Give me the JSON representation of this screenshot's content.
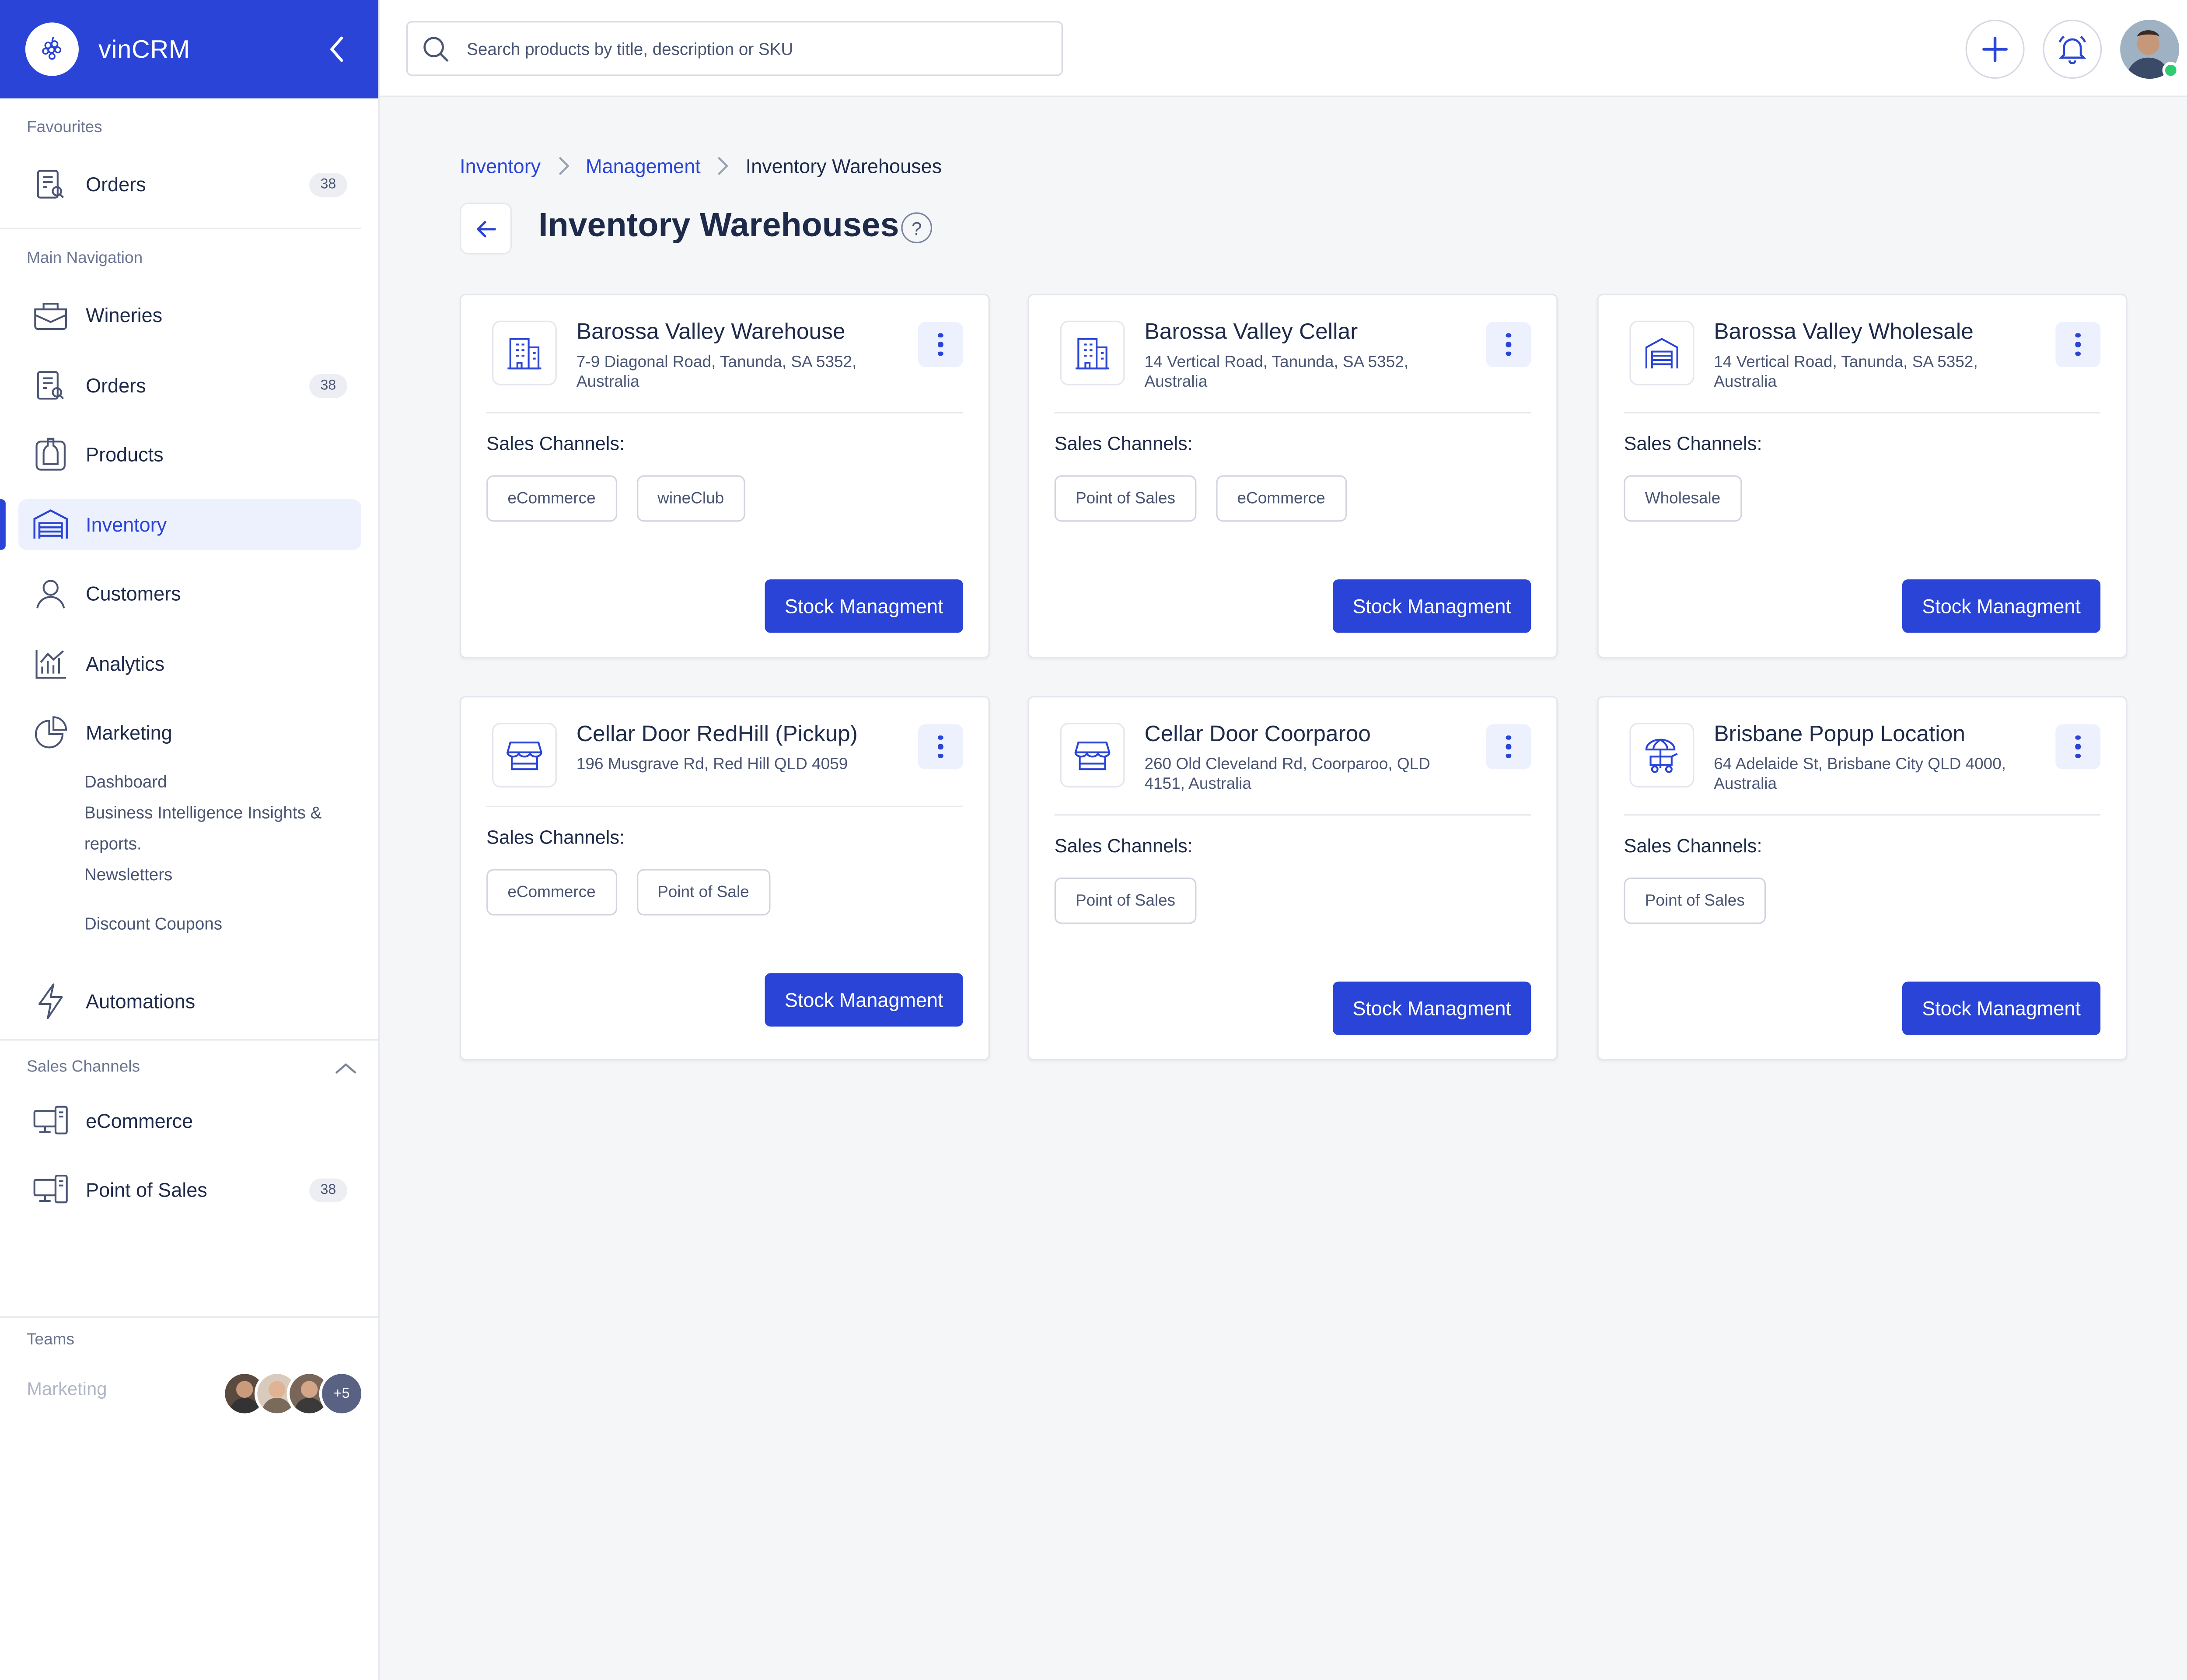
{
  "brand": {
    "name": "vinCRM"
  },
  "search": {
    "placeholder": "Search products by title, description or SKU"
  },
  "sidebar": {
    "favourites_label": "Favourites",
    "favourites": [
      {
        "label": "Orders",
        "badge": "38",
        "icon": "clipboard-search-icon"
      }
    ],
    "main_nav_label": "Main Navigation",
    "items": [
      {
        "label": "Wineries",
        "icon": "wine-case-icon"
      },
      {
        "label": "Orders",
        "badge": "38",
        "icon": "clipboard-search-icon"
      },
      {
        "label": "Products",
        "icon": "bottle-icon"
      },
      {
        "label": "Inventory",
        "icon": "warehouse-icon",
        "active": true
      },
      {
        "label": "Customers",
        "icon": "user-icon"
      },
      {
        "label": "Analytics",
        "icon": "chart-icon"
      },
      {
        "label": "Marketing",
        "icon": "pie-chart-icon"
      }
    ],
    "marketing_sub": [
      "Dashboard",
      "Business Intelligence Insights &",
      "reports.",
      "Newsletters",
      "Discount Coupons"
    ],
    "automations": {
      "label": "Automations",
      "icon": "lightning-icon"
    },
    "sales_channels_label": "Sales Channels",
    "sales_channels": [
      {
        "label": "eCommerce",
        "icon": "devices-icon"
      },
      {
        "label": "Point of Sales",
        "badge": "38",
        "icon": "devices-icon"
      }
    ],
    "teams_label": "Teams",
    "team": {
      "name": "Marketing",
      "more": "+5"
    }
  },
  "breadcrumb": [
    "Inventory",
    "Management",
    "Inventory Warehouses"
  ],
  "page_title": "Inventory Warehouses",
  "help_label": "?",
  "sales_channels_heading": "Sales Channels:",
  "stock_button": "Stock Managment",
  "warehouses": [
    {
      "name": "Barossa Valley Warehouse",
      "address": "7-9 Diagonal Road, Tanunda, SA 5352, Australia",
      "channels": [
        "eCommerce",
        "wineClub"
      ],
      "icon": "building-icon"
    },
    {
      "name": "Barossa Valley Cellar",
      "address": "14 Vertical Road, Tanunda, SA 5352, Australia",
      "channels": [
        "Point of Sales",
        "eCommerce"
      ],
      "icon": "building-icon"
    },
    {
      "name": "Barossa Valley Wholesale",
      "address": "14 Vertical Road, Tanunda, SA 5352, Australia",
      "channels": [
        "Wholesale"
      ],
      "icon": "warehouse-icon"
    },
    {
      "name": "Cellar Door RedHill (Pickup)",
      "address": "196 Musgrave Rd, Red Hill QLD 4059",
      "channels": [
        "eCommerce",
        "Point of Sale"
      ],
      "icon": "storefront-icon"
    },
    {
      "name": "Cellar Door Coorparoo",
      "address": "260 Old Cleveland Rd, Coorparoo, QLD 4151, Australia",
      "channels": [
        "Point of Sales"
      ],
      "icon": "storefront-icon"
    },
    {
      "name": "Brisbane Popup Location",
      "address": "64 Adelaide St, Brisbane City QLD 4000, Australia",
      "channels": [
        "Point of Sales"
      ],
      "icon": "market-stall-icon"
    }
  ],
  "colors": {
    "accent": "#2944d6",
    "accent_soft": "#edf1fd",
    "text": "#1e2a4a",
    "muted": "#4a5573",
    "online": "#2ecc71"
  }
}
